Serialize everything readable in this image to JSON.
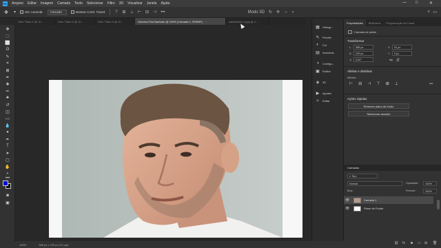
{
  "menubar": {
    "logo": "Ps",
    "items": [
      "Arquivo",
      "Editar",
      "Imagem",
      "Camada",
      "Texto",
      "Selecionar",
      "Filtro",
      "3D",
      "Visualizar",
      "Janela",
      "Ajuda"
    ],
    "minimize": "—",
    "maximize": "□",
    "close": "✕"
  },
  "options": {
    "auto_select": "Sel. Automát.",
    "target": "Camada",
    "transform_controls": "Mostrar Contr. Transf.",
    "mode_3d": "Modo 3D"
  },
  "tabs": [
    {
      "label": "Sem Título-1 @ 10...",
      "active": false
    },
    {
      "label": "Sem Título-2 @ 10...",
      "active": false
    },
    {
      "label": "Sem Título-3 @ 10...",
      "active": false
    },
    {
      "label": "Homem-Fios-Barbudo @ 100% (Camada 1, RGB/8*)",
      "active": true
    },
    {
      "label": "cabeleireiro-1.jpg @ 1...",
      "active": false
    }
  ],
  "status": {
    "zoom": "100%",
    "info": "368 px x 229 px (72 ppi)"
  },
  "panel_icons": [
    {
      "icon": "histogram-icon",
      "glyph": "▦",
      "label": "Histogr..."
    },
    {
      "icon": "brush-icon",
      "glyph": "✎",
      "label": "Pincéis"
    },
    {
      "icon": "color-icon",
      "glyph": "◐",
      "label": "Cor"
    },
    {
      "icon": "swatches-icon",
      "glyph": "▤",
      "label": "Amostras"
    },
    {
      "icon": "adjust-icon",
      "glyph": "◑",
      "label": "Configu..."
    },
    {
      "icon": "styles-icon",
      "glyph": "▣",
      "label": "Estilos"
    },
    {
      "icon": "threed-icon",
      "glyph": "◈",
      "label": "3D"
    },
    {
      "icon": "actions-icon",
      "glyph": "▶",
      "label": "Ajustes"
    },
    {
      "icon": "paths-icon",
      "glyph": "✧",
      "label": "Editar"
    }
  ],
  "right_panel": {
    "tabs": [
      "Propriedades",
      "Biblioteca",
      "Programação de Canal"
    ],
    "sub": "Camada de pixels",
    "transform_title": "Transformar",
    "fields": {
      "w_label": "L",
      "w": "368 px",
      "h_label": "A",
      "h": "229 px",
      "x_label": "X",
      "x": "51 px",
      "y_label": "Y",
      "y": "0 px",
      "angle": "0,00°"
    },
    "align_title": "Alinhar e distribuir",
    "align_label": "Alinhar:",
    "quick_title": "Ações rápidas",
    "btn_remove_bg": "Remover plano de fundo",
    "btn_select_subject": "Selecionar assunto"
  },
  "layers": {
    "title": "Camadas",
    "kind": "Tipo",
    "blend": "Normal",
    "opacity_label": "Opacidade:",
    "opacity": "100%",
    "fill_label": "Preench.:",
    "fill": "100%",
    "lock_label": "Bloq.:",
    "items": [
      {
        "name": "Camada 1",
        "selected": true
      },
      {
        "name": "Plano de Fundo",
        "selected": false
      }
    ]
  }
}
